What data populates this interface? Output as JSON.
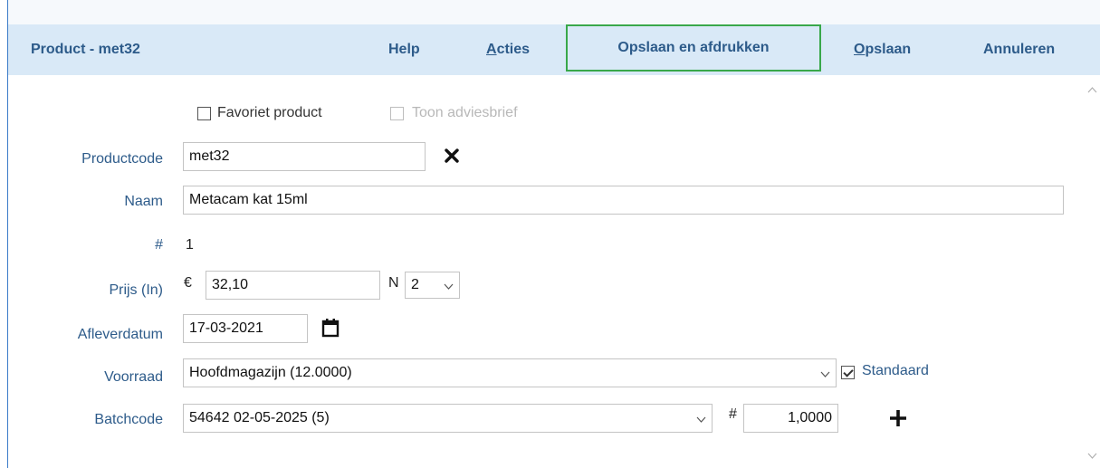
{
  "toolbar": {
    "title": "Product - met32",
    "help": "Help",
    "acties_first": "A",
    "acties_rest": "cties",
    "print": "Opslaan en afdrukken",
    "save_first": "O",
    "save_rest": "pslaan",
    "cancel": "Annuleren"
  },
  "options": {
    "favoriet": "Favoriet product",
    "advies": "Toon adviesbrief"
  },
  "fields": {
    "productcode_label": "Productcode",
    "productcode_value": "met32",
    "naam_label": "Naam",
    "naam_value": "Metacam kat 15ml",
    "hash_label": "#",
    "hash_value": "1",
    "prijs_label": "Prijs (In)",
    "currency": "€",
    "prijs_value": "32,10",
    "n_label": "N",
    "n_value": "2",
    "afleverdatum_label": "Afleverdatum",
    "afleverdatum_value": "17-03-2021",
    "voorraad_label": "Voorraad",
    "voorraad_value": "Hoofdmagazijn (12.0000)",
    "standaard_label": "Standaard",
    "batchcode_label": "Batchcode",
    "batchcode_value": "54642 02-05-2025 (5)",
    "qty_hash": "#",
    "qty_value": "1,0000"
  },
  "colors": {
    "toolbar_bg": "#d9e9f7",
    "accent_text": "#2d5b8a",
    "print_border": "#39a84a"
  },
  "icons": {
    "clear": "close-icon",
    "calendar": "calendar-icon",
    "add": "plus-icon"
  }
}
